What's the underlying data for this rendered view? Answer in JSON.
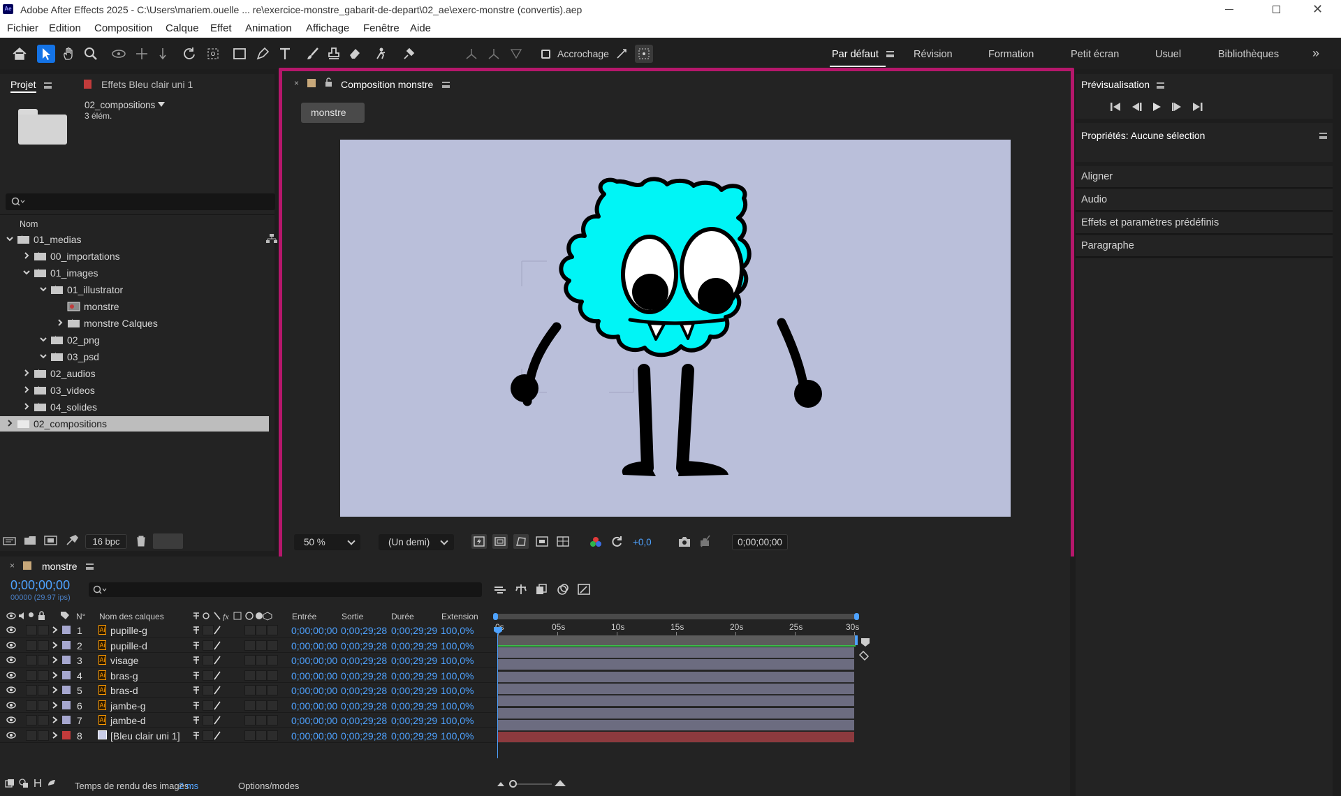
{
  "window": {
    "title": "Adobe After Effects 2025 - C:\\Users\\mariem.ouelle ... re\\exercice-monstre_gabarit-de-depart\\02_ae\\exerc-monstre (convertis).aep",
    "app_badge": "Ae"
  },
  "menu": [
    "Fichier",
    "Edition",
    "Composition",
    "Calque",
    "Effet",
    "Animation",
    "Affichage",
    "Fenêtre",
    "Aide"
  ],
  "toolbar": {
    "snapping_label": "Accrochage"
  },
  "workspaces": [
    "Par défaut",
    "Révision",
    "Formation",
    "Petit écran",
    "Usuel",
    "Bibliothèques"
  ],
  "project": {
    "tab_label": "Projet",
    "effects_tab_label": "Effets Bleu clair uni 1",
    "selected_name": "02_compositions",
    "selected_info": "3 élém.",
    "column_name": "Nom",
    "items": [
      {
        "label": "01_medias",
        "depth": 0,
        "state": "open",
        "type": "folder"
      },
      {
        "label": "00_importations",
        "depth": 1,
        "state": "closed",
        "type": "folder"
      },
      {
        "label": "01_images",
        "depth": 1,
        "state": "open",
        "type": "folder"
      },
      {
        "label": "01_illustrator",
        "depth": 2,
        "state": "open",
        "type": "folder"
      },
      {
        "label": "monstre",
        "depth": 3,
        "state": "none",
        "type": "comp"
      },
      {
        "label": "monstre Calques",
        "depth": 3,
        "state": "closed",
        "type": "folder"
      },
      {
        "label": "02_png",
        "depth": 2,
        "state": "open",
        "type": "folder"
      },
      {
        "label": "03_psd",
        "depth": 2,
        "state": "open",
        "type": "folder"
      },
      {
        "label": "02_audios",
        "depth": 1,
        "state": "closed",
        "type": "folder"
      },
      {
        "label": "03_videos",
        "depth": 1,
        "state": "closed",
        "type": "folder"
      },
      {
        "label": "04_solides",
        "depth": 1,
        "state": "closed",
        "type": "folder"
      },
      {
        "label": "02_compositions",
        "depth": 0,
        "state": "closed",
        "type": "folder",
        "selected": true
      }
    ],
    "bpc_label": "16 bpc"
  },
  "composition": {
    "tab_label": "Composition monstre",
    "crumb_label": "monstre",
    "bg_color": "#babfda",
    "highlight_color": "#b5176b",
    "zoom": "50 %",
    "resolution": "(Un demi)",
    "exposure": "+0,0",
    "timecode": "0;00;00;00"
  },
  "right_panel": {
    "preview_title": "Prévisualisation",
    "properties_title": "Propriétés: Aucune sélection",
    "sections": [
      "Aligner",
      "Audio",
      "Effets et paramètres prédéfinis",
      "Paragraphe"
    ]
  },
  "timeline": {
    "tab_label": "monstre",
    "current_time": "0;00;00;00",
    "fps_info": "00000 (29.97 ips)",
    "columns": {
      "num": "N°",
      "name": "Nom des calques",
      "in": "Entrée",
      "out": "Sortie",
      "duration": "Durée",
      "stretch": "Extension"
    },
    "ruler": [
      "0s",
      "05s",
      "10s",
      "15s",
      "20s",
      "25s",
      "30s"
    ],
    "layers": [
      {
        "num": "1",
        "name": "pupille-g",
        "label_color": "#a6a7cf",
        "in": "0;00;00;00",
        "out": "0;00;29;28",
        "duration": "0;00;29;29",
        "stretch": "100,0%"
      },
      {
        "num": "2",
        "name": "pupille-d",
        "label_color": "#a6a7cf",
        "in": "0;00;00;00",
        "out": "0;00;29;28",
        "duration": "0;00;29;29",
        "stretch": "100,0%"
      },
      {
        "num": "3",
        "name": "visage",
        "label_color": "#a6a7cf",
        "in": "0;00;00;00",
        "out": "0;00;29;28",
        "duration": "0;00;29;29",
        "stretch": "100,0%"
      },
      {
        "num": "4",
        "name": "bras-g",
        "label_color": "#a6a7cf",
        "in": "0;00;00;00",
        "out": "0;00;29;28",
        "duration": "0;00;29;29",
        "stretch": "100,0%"
      },
      {
        "num": "5",
        "name": "bras-d",
        "label_color": "#a6a7cf",
        "in": "0;00;00;00",
        "out": "0;00;29;28",
        "duration": "0;00;29;29",
        "stretch": "100,0%"
      },
      {
        "num": "6",
        "name": "jambe-g",
        "label_color": "#a6a7cf",
        "in": "0;00;00;00",
        "out": "0;00;29;28",
        "duration": "0;00;29;29",
        "stretch": "100,0%"
      },
      {
        "num": "7",
        "name": "jambe-d",
        "label_color": "#a6a7cf",
        "in": "0;00;00;00",
        "out": "0;00;29;28",
        "duration": "0;00;29;29",
        "stretch": "100,0%"
      },
      {
        "num": "8",
        "name": "[Bleu clair uni 1]",
        "label_color": "#c23b3b",
        "in": "0;00;00;00",
        "out": "0;00;29;28",
        "duration": "0;00;29;29",
        "stretch": "100,0%"
      }
    ],
    "render_label": "Temps de rendu des images :",
    "render_value": "2 ms",
    "options_label": "Options/modes"
  }
}
